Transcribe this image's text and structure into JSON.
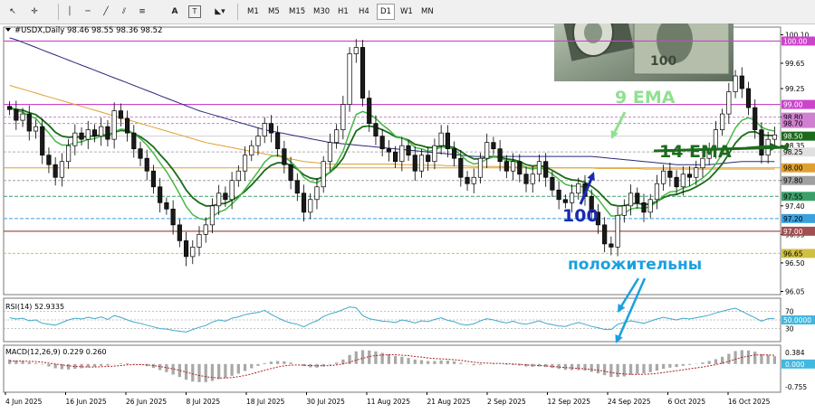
{
  "toolbar": {
    "timeframes": [
      "M1",
      "M5",
      "M15",
      "M30",
      "H1",
      "H4",
      "D1",
      "W1",
      "MN"
    ],
    "active_timeframe": "D1"
  },
  "colors": {
    "ema9": "#45b845",
    "ema14": "#1a6b1a",
    "ma100": "#2a2a7a",
    "ma200": "#e0a030",
    "bull_candle": "#ffffff",
    "bear_candle": "#1a1a1a",
    "magenta_level": "#cc44cc",
    "brown_level": "#a05050",
    "green_dash": "#3aa06a",
    "rsi_line": "#40a8c8",
    "macd_signal": "#b02020",
    "annotation_green": "#1d6b1d",
    "annotation_lightgreen": "#90e090",
    "annotation_blue": "#1a2ab0",
    "annotation_cyan": "#1aa0e0"
  },
  "chart_data": {
    "type": "candlestick",
    "symbol_header": "#USDX,Daily  98.46 98.55 98.36 98.52",
    "price_range": [
      96.0,
      100.22
    ],
    "price_ticks": [
      "100.10",
      "99.65",
      "99.25",
      "98.80",
      "98.35",
      "97.80",
      "97.40",
      "96.95",
      "96.50",
      "96.05"
    ],
    "level_labels": [
      {
        "value": 100.0,
        "label": "100.00",
        "color": "#cc44cc"
      },
      {
        "value": 99.0,
        "label": "99.00",
        "color": "#cc44cc"
      },
      {
        "value": 98.8,
        "label": "98.80",
        "color": "#d080d0"
      },
      {
        "value": 98.7,
        "label": "98.70",
        "color": "#d080d0"
      },
      {
        "value": 98.5,
        "label": "98.50",
        "color": "#1a6b1a"
      },
      {
        "value": 98.25,
        "label": "98.25",
        "color": "#e0e0e0"
      },
      {
        "value": 98.0,
        "label": "98.00",
        "color": "#e0a030"
      },
      {
        "value": 97.8,
        "label": "97.80",
        "color": "#a0a0a0"
      },
      {
        "value": 97.55,
        "label": "97.55",
        "color": "#3aa06a"
      },
      {
        "value": 97.2,
        "label": "97.20",
        "color": "#3aa0e0"
      },
      {
        "value": 97.0,
        "label": "97.00",
        "color": "#a05050"
      },
      {
        "value": 96.65,
        "label": "96.65",
        "color": "#d0c040"
      }
    ],
    "x_labels": [
      "4 Jun 2025",
      "16 Jun 2025",
      "26 Jun 2025",
      "8 Jul 2025",
      "18 Jul 2025",
      "30 Jul 2025",
      "11 Aug 2025",
      "21 Aug 2025",
      "2 Sep 2025",
      "12 Sep 2025",
      "24 Sep 2025",
      "6 Oct 2025",
      "16 Oct 2025"
    ],
    "close": [
      98.92,
      98.75,
      98.85,
      98.58,
      98.65,
      98.2,
      98.05,
      97.85,
      98.1,
      98.35,
      98.55,
      98.45,
      98.6,
      98.5,
      98.65,
      98.45,
      98.9,
      98.78,
      98.55,
      98.3,
      98.15,
      97.95,
      97.7,
      97.45,
      97.35,
      97.1,
      96.85,
      96.6,
      96.75,
      96.95,
      97.1,
      97.4,
      97.6,
      97.5,
      97.8,
      97.95,
      98.2,
      98.35,
      98.5,
      98.7,
      98.55,
      98.3,
      98.05,
      97.8,
      97.6,
      97.3,
      97.5,
      97.7,
      98.1,
      98.4,
      98.6,
      99.0,
      99.8,
      99.9,
      99.1,
      98.7,
      98.5,
      98.3,
      98.25,
      98.1,
      98.35,
      98.2,
      97.95,
      98.2,
      98.1,
      98.35,
      98.55,
      98.3,
      98.15,
      97.85,
      97.75,
      97.85,
      98.15,
      98.4,
      98.3,
      98.1,
      97.95,
      98.1,
      97.9,
      97.75,
      97.9,
      98.1,
      97.85,
      97.65,
      97.5,
      97.45,
      97.6,
      97.75,
      97.55,
      97.3,
      97.1,
      96.8,
      96.75,
      97.25,
      97.4,
      97.6,
      97.45,
      97.3,
      97.5,
      97.75,
      97.95,
      97.85,
      97.7,
      97.9,
      97.85,
      98.0,
      98.15,
      98.3,
      98.6,
      98.85,
      99.2,
      99.45,
      99.25,
      98.95,
      98.6,
      98.2,
      98.45,
      98.52
    ],
    "ema9": [
      98.95,
      98.9,
      98.88,
      98.82,
      98.78,
      98.66,
      98.55,
      98.42,
      98.36,
      98.36,
      98.4,
      98.41,
      98.45,
      98.46,
      98.5,
      98.49,
      98.57,
      98.61,
      98.6,
      98.54,
      98.46,
      98.36,
      98.23,
      98.08,
      97.94,
      97.77,
      97.59,
      97.39,
      97.26,
      97.2,
      97.18,
      97.23,
      97.3,
      97.34,
      97.43,
      97.53,
      97.66,
      97.8,
      97.94,
      98.09,
      98.18,
      98.2,
      98.17,
      98.1,
      97.99,
      97.85,
      97.78,
      97.76,
      97.83,
      97.94,
      98.07,
      98.26,
      98.56,
      98.84,
      98.89,
      98.85,
      98.78,
      98.68,
      98.6,
      98.5,
      98.47,
      98.42,
      98.32,
      98.3,
      98.26,
      98.28,
      98.33,
      98.32,
      98.29,
      98.2,
      98.11,
      98.06,
      98.08,
      98.14,
      98.17,
      98.16,
      98.11,
      98.11,
      98.07,
      98.0,
      97.98,
      98.0,
      97.97,
      97.9,
      97.82,
      97.74,
      97.71,
      97.72,
      97.69,
      97.61,
      97.51,
      97.37,
      97.24,
      97.24,
      97.28,
      97.35,
      97.37,
      97.36,
      97.39,
      97.46,
      97.56,
      97.62,
      97.63,
      97.68,
      97.71,
      97.77,
      97.84,
      97.93,
      98.06,
      98.22,
      98.42,
      98.63,
      98.75,
      98.79,
      98.75,
      98.64,
      98.6,
      98.58
    ],
    "ema14": [
      98.95,
      98.92,
      98.91,
      98.87,
      98.84,
      98.76,
      98.67,
      98.56,
      98.5,
      98.48,
      98.49,
      98.48,
      98.5,
      98.5,
      98.52,
      98.51,
      98.56,
      98.59,
      98.58,
      98.54,
      98.49,
      98.42,
      98.33,
      98.21,
      98.1,
      97.97,
      97.82,
      97.65,
      97.53,
      97.45,
      97.4,
      97.4,
      97.43,
      97.44,
      97.49,
      97.55,
      97.63,
      97.73,
      97.84,
      97.96,
      98.04,
      98.08,
      98.08,
      98.04,
      97.98,
      97.89,
      97.84,
      97.82,
      97.86,
      97.93,
      98.02,
      98.15,
      98.37,
      98.58,
      98.65,
      98.66,
      98.64,
      98.6,
      98.55,
      98.49,
      98.47,
      98.44,
      98.37,
      98.35,
      98.32,
      98.32,
      98.35,
      98.34,
      98.32,
      98.26,
      98.19,
      98.14,
      98.14,
      98.17,
      98.18,
      98.17,
      98.14,
      98.13,
      98.1,
      98.05,
      98.03,
      98.04,
      98.01,
      97.96,
      97.9,
      97.84,
      97.81,
      97.8,
      97.77,
      97.71,
      97.63,
      97.52,
      97.42,
      97.4,
      97.4,
      97.43,
      97.44,
      97.42,
      97.43,
      97.47,
      97.53,
      97.57,
      97.58,
      97.62,
      97.65,
      97.7,
      97.76,
      97.83,
      97.94,
      98.06,
      98.22,
      98.39,
      98.5,
      98.56,
      98.57,
      98.52,
      98.51,
      98.51
    ],
    "ma100": [
      100.05,
      100.02,
      99.98,
      99.94,
      99.9,
      99.86,
      99.82,
      99.78,
      99.74,
      99.7,
      99.66,
      99.62,
      99.58,
      99.54,
      99.5,
      99.46,
      99.42,
      99.38,
      99.34,
      99.3,
      99.26,
      99.22,
      99.18,
      99.14,
      99.1,
      99.06,
      99.02,
      98.98,
      98.94,
      98.9,
      98.87,
      98.84,
      98.81,
      98.78,
      98.75,
      98.72,
      98.69,
      98.66,
      98.63,
      98.6,
      98.58,
      98.56,
      98.54,
      98.52,
      98.5,
      98.48,
      98.46,
      98.44,
      98.42,
      98.4,
      98.39,
      98.38,
      98.37,
      98.36,
      98.35,
      98.34,
      98.33,
      98.32,
      98.31,
      98.3,
      98.29,
      98.28,
      98.27,
      98.26,
      98.25,
      98.24,
      98.23,
      98.22,
      98.21,
      98.2,
      98.19,
      98.18,
      98.18,
      98.18,
      98.18,
      98.18,
      98.18,
      98.18,
      98.18,
      98.18,
      98.18,
      98.18,
      98.18,
      98.18,
      98.18,
      98.18,
      98.18,
      98.18,
      98.18,
      98.18,
      98.17,
      98.16,
      98.15,
      98.14,
      98.13,
      98.12,
      98.11,
      98.1,
      98.09,
      98.08,
      98.07,
      98.06,
      98.05,
      98.05,
      98.05,
      98.05,
      98.05,
      98.05,
      98.06,
      98.07,
      98.08,
      98.09,
      98.1,
      98.1,
      98.1,
      98.1,
      98.1,
      98.1
    ],
    "ma200": [
      99.3,
      99.27,
      99.24,
      99.21,
      99.18,
      99.15,
      99.12,
      99.09,
      99.06,
      99.03,
      99.0,
      98.97,
      98.94,
      98.91,
      98.88,
      98.85,
      98.82,
      98.79,
      98.76,
      98.73,
      98.7,
      98.67,
      98.64,
      98.61,
      98.58,
      98.55,
      98.52,
      98.49,
      98.46,
      98.43,
      98.4,
      98.38,
      98.36,
      98.34,
      98.32,
      98.3,
      98.28,
      98.26,
      98.24,
      98.22,
      98.2,
      98.18,
      98.16,
      98.14,
      98.12,
      98.1,
      98.09,
      98.08,
      98.07,
      98.06,
      98.06,
      98.06,
      98.06,
      98.06,
      98.06,
      98.06,
      98.06,
      98.06,
      98.06,
      98.06,
      98.05,
      98.05,
      98.05,
      98.04,
      98.04,
      98.04,
      98.04,
      98.03,
      98.03,
      98.03,
      98.03,
      98.02,
      98.02,
      98.02,
      98.02,
      98.02,
      98.02,
      98.01,
      98.01,
      98.01,
      98.01,
      98.01,
      98.01,
      98.0,
      98.0,
      98.0,
      98.0,
      98.0,
      98.0,
      98.0,
      97.99,
      97.99,
      97.99,
      97.99,
      97.99,
      97.99,
      97.99,
      97.98,
      97.98,
      97.98,
      97.98,
      97.98,
      97.98,
      97.98,
      97.98,
      97.98,
      97.98,
      97.98,
      97.98,
      97.98,
      97.98,
      97.98,
      97.98,
      97.98,
      97.98,
      97.98,
      97.98,
      97.98
    ],
    "rsi": {
      "label": "RSI(14) 52.9335",
      "range": [
        0,
        100
      ],
      "ticks": [
        70,
        30
      ],
      "right_label": "50.0000",
      "values": [
        55,
        52,
        54,
        48,
        50,
        42,
        40,
        38,
        44,
        50,
        54,
        52,
        56,
        53,
        57,
        51,
        60,
        56,
        50,
        45,
        42,
        38,
        34,
        30,
        29,
        26,
        24,
        22,
        28,
        33,
        37,
        45,
        50,
        47,
        54,
        57,
        62,
        65,
        67,
        72,
        63,
        55,
        48,
        43,
        40,
        34,
        42,
        48,
        58,
        64,
        68,
        74,
        80,
        78,
        60,
        53,
        50,
        47,
        46,
        44,
        50,
        47,
        43,
        48,
        46,
        51,
        55,
        49,
        46,
        40,
        38,
        41,
        48,
        53,
        50,
        46,
        43,
        47,
        42,
        40,
        44,
        48,
        42,
        39,
        36,
        35,
        40,
        44,
        40,
        35,
        32,
        28,
        28,
        40,
        44,
        48,
        45,
        42,
        47,
        52,
        56,
        53,
        50,
        54,
        52,
        55,
        58,
        61,
        66,
        70,
        74,
        77,
        70,
        62,
        55,
        47,
        53,
        53
      ]
    },
    "macd": {
      "label": "MACD(12,26,9) 0.229 0.260",
      "ticks": [
        "0.384",
        "0.000",
        "-0.755"
      ],
      "hist": [
        0.15,
        0.12,
        0.1,
        0.06,
        0.03,
        -0.02,
        -0.08,
        -0.14,
        -0.17,
        -0.18,
        -0.16,
        -0.14,
        -0.11,
        -0.09,
        -0.06,
        -0.05,
        -0.01,
        0.02,
        0.03,
        0.01,
        -0.02,
        -0.07,
        -0.13,
        -0.2,
        -0.27,
        -0.35,
        -0.43,
        -0.52,
        -0.58,
        -0.6,
        -0.6,
        -0.56,
        -0.5,
        -0.46,
        -0.39,
        -0.32,
        -0.23,
        -0.14,
        -0.06,
        0.03,
        0.08,
        0.1,
        0.09,
        0.05,
        -0.0,
        -0.07,
        -0.11,
        -0.12,
        -0.08,
        -0.02,
        0.05,
        0.15,
        0.3,
        0.42,
        0.46,
        0.45,
        0.42,
        0.37,
        0.33,
        0.27,
        0.24,
        0.2,
        0.15,
        0.13,
        0.1,
        0.1,
        0.12,
        0.11,
        0.09,
        0.04,
        -0.01,
        -0.04,
        -0.03,
        0.0,
        0.01,
        0.0,
        -0.02,
        -0.03,
        -0.05,
        -0.08,
        -0.09,
        -0.08,
        -0.1,
        -0.13,
        -0.16,
        -0.19,
        -0.2,
        -0.2,
        -0.22,
        -0.26,
        -0.31,
        -0.37,
        -0.43,
        -0.43,
        -0.41,
        -0.36,
        -0.33,
        -0.31,
        -0.27,
        -0.22,
        -0.16,
        -0.12,
        -0.1,
        -0.06,
        -0.03,
        0.01,
        0.05,
        0.1,
        0.16,
        0.24,
        0.34,
        0.43,
        0.46,
        0.45,
        0.41,
        0.33,
        0.3,
        0.26
      ],
      "signal": [
        0.1,
        0.1,
        0.1,
        0.09,
        0.08,
        0.06,
        0.03,
        0.0,
        -0.03,
        -0.06,
        -0.08,
        -0.09,
        -0.1,
        -0.1,
        -0.09,
        -0.08,
        -0.07,
        -0.05,
        -0.03,
        -0.02,
        -0.02,
        -0.03,
        -0.05,
        -0.08,
        -0.12,
        -0.16,
        -0.21,
        -0.27,
        -0.33,
        -0.38,
        -0.42,
        -0.45,
        -0.46,
        -0.46,
        -0.45,
        -0.42,
        -0.38,
        -0.33,
        -0.27,
        -0.21,
        -0.15,
        -0.1,
        -0.06,
        -0.04,
        -0.03,
        -0.04,
        -0.05,
        -0.06,
        -0.06,
        -0.05,
        -0.03,
        0.0,
        0.06,
        0.13,
        0.19,
        0.25,
        0.28,
        0.3,
        0.31,
        0.31,
        0.29,
        0.28,
        0.25,
        0.23,
        0.2,
        0.18,
        0.17,
        0.16,
        0.14,
        0.12,
        0.09,
        0.06,
        0.04,
        0.03,
        0.02,
        0.02,
        0.01,
        0.0,
        -0.01,
        -0.03,
        -0.04,
        -0.05,
        -0.06,
        -0.08,
        -0.1,
        -0.12,
        -0.13,
        -0.15,
        -0.16,
        -0.18,
        -0.21,
        -0.24,
        -0.28,
        -0.31,
        -0.33,
        -0.34,
        -0.34,
        -0.34,
        -0.33,
        -0.31,
        -0.28,
        -0.25,
        -0.22,
        -0.19,
        -0.16,
        -0.13,
        -0.1,
        -0.06,
        -0.02,
        0.03,
        0.09,
        0.16,
        0.22,
        0.26,
        0.3,
        0.3,
        0.3,
        0.29
      ]
    }
  },
  "annotations": {
    "ema9": "9 EMA",
    "ema14": "14 EMA",
    "ma100": "100",
    "positive": "положительны"
  }
}
